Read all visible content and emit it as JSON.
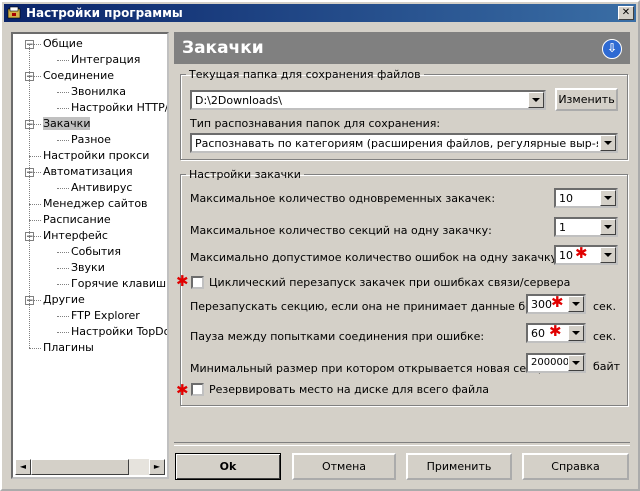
{
  "window": {
    "title": "Настройки программы"
  },
  "tree": {
    "items": [
      {
        "label": "Общие",
        "level": 0,
        "expander": "−"
      },
      {
        "label": "Интеграция",
        "level": 1
      },
      {
        "label": "Соединение",
        "level": 0,
        "expander": "−"
      },
      {
        "label": "Звонилка",
        "level": 1
      },
      {
        "label": "Настройки HTTP/FTP",
        "level": 1
      },
      {
        "label": "Закачки",
        "level": 0,
        "expander": "−",
        "selected": true
      },
      {
        "label": "Разное",
        "level": 1
      },
      {
        "label": "Настройки прокси",
        "level": 0
      },
      {
        "label": "Автоматизация",
        "level": 0,
        "expander": "−"
      },
      {
        "label": "Антивирус",
        "level": 1
      },
      {
        "label": "Менеджер сайтов",
        "level": 0
      },
      {
        "label": "Расписание",
        "level": 0
      },
      {
        "label": "Интерфейс",
        "level": 0,
        "expander": "−"
      },
      {
        "label": "События",
        "level": 1
      },
      {
        "label": "Звуки",
        "level": 1
      },
      {
        "label": "Горячие клавиши",
        "level": 1
      },
      {
        "label": "Другие",
        "level": 0,
        "expander": "−"
      },
      {
        "label": "FTP Explorer",
        "level": 1
      },
      {
        "label": "Настройки TopDownloader",
        "level": 1
      },
      {
        "label": "Плагины",
        "level": 0
      }
    ],
    "scroll_left": "◄",
    "scroll_right": "►"
  },
  "header": {
    "title": "Закачки",
    "info_icon": "⇩"
  },
  "folder_group": {
    "legend": "Текущая папка для сохранения файлов",
    "path_value": "D:\\2Downloads\\",
    "change_button": "Изменить",
    "recognition_label": "Тип распознавания папок для сохранения:",
    "recognition_value": "Распознавать по категориям (расширения файлов, регулярные выр-я для URL)"
  },
  "download_group": {
    "legend": "Настройки закачки",
    "max_downloads_label": "Максимальное количество одновременных закачек:",
    "max_downloads_value": "10",
    "max_sections_label": "Максимальное количество секций на одну закачку:",
    "max_sections_value": "1",
    "max_errors_label": "Максимально допустимое количество ошибок на одну закачку:",
    "max_errors_value": "10",
    "cyclic_restart_label": "Циклический перезапуск закачек при ошибках связи/сервера",
    "restart_section_label": "Перезапускать секцию, если она не принимает данные более:",
    "restart_section_value": "300",
    "restart_section_unit": "сек.",
    "pause_label": "Пауза между попытками соединения при ошибке:",
    "pause_value": "60",
    "pause_unit": "сек.",
    "min_size_label": "Минимальный размер при котором открывается новая секция:",
    "min_size_value": "200000",
    "min_size_unit": "байт",
    "reserve_label": "Резервировать место на диске для всего файла"
  },
  "star": "✱",
  "buttons": {
    "ok": "Ok",
    "cancel": "Отмена",
    "apply": "Применить",
    "help": "Справка"
  }
}
